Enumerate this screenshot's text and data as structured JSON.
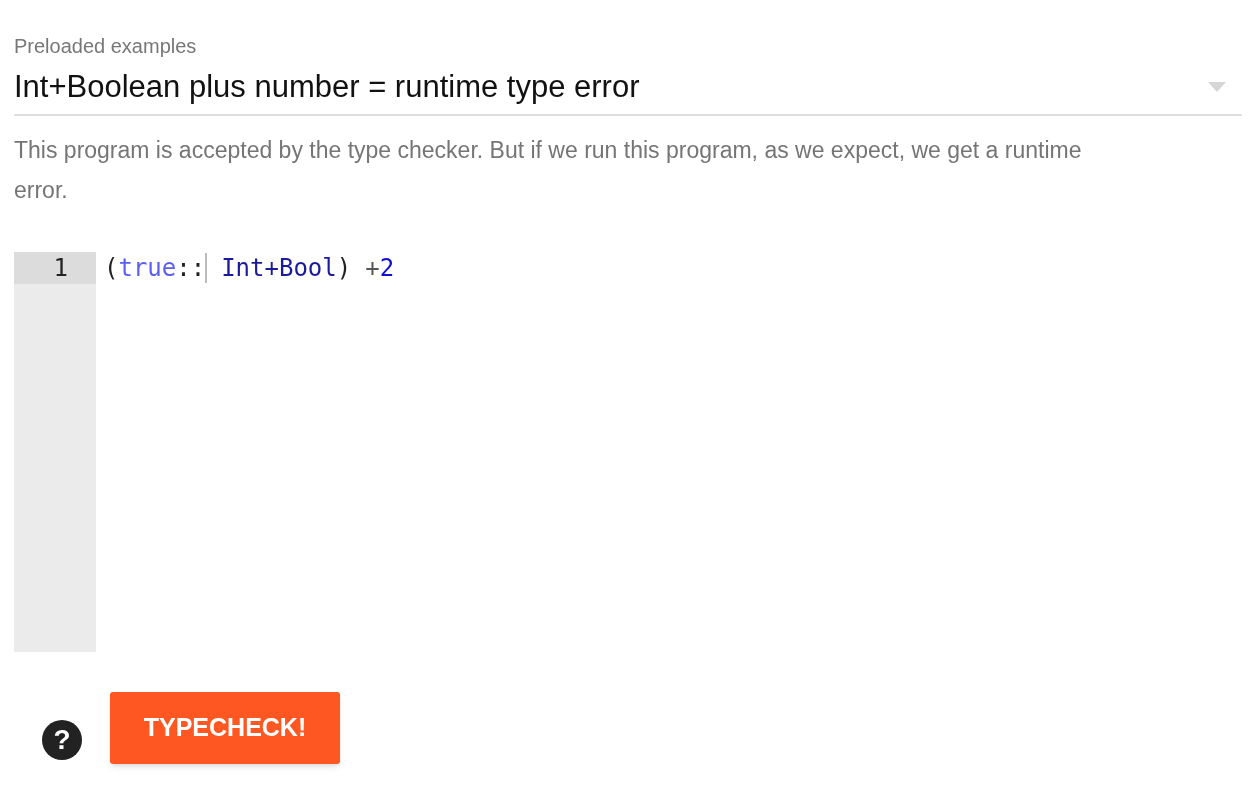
{
  "examples_select": {
    "label": "Preloaded examples",
    "value": "Int+Boolean plus number = runtime type error"
  },
  "description": "This program is accepted by the type checker. But if we run this program, as we expect, we get a runtime error.",
  "editor": {
    "lines": [
      {
        "number": "1",
        "active": true,
        "tokens": [
          {
            "kind": "bracket",
            "text": "("
          },
          {
            "kind": "atom",
            "text": "true"
          },
          {
            "kind": "punct",
            "text": "::",
            "cursor_after": true
          },
          {
            "kind": "type",
            "text": "Int+Bool",
            "space_before": true
          },
          {
            "kind": "bracket",
            "text": ")"
          },
          {
            "kind": "operator",
            "text": "+",
            "space_before": true
          },
          {
            "kind": "number",
            "text": "2"
          }
        ]
      }
    ]
  },
  "help_button": {
    "label": "?"
  },
  "typecheck_button": {
    "label": "TYPECHECK!"
  }
}
